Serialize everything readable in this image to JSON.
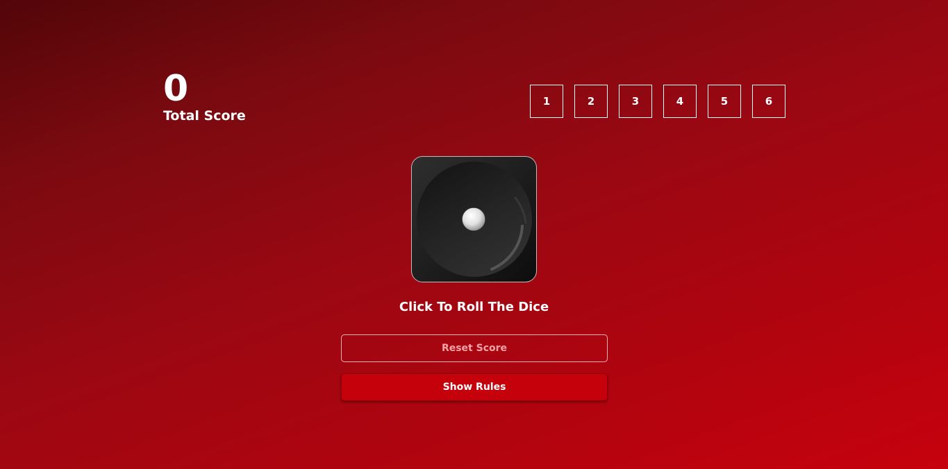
{
  "score": {
    "value": "0",
    "label": "Total Score"
  },
  "number_selector": {
    "options": [
      "1",
      "2",
      "3",
      "4",
      "5",
      "6"
    ]
  },
  "dice": {
    "face": 1,
    "icon": "dice-face-one-icon"
  },
  "instruction": "Click To Roll The Dice",
  "buttons": {
    "reset_label": "Reset Score",
    "rules_label": "Show Rules"
  },
  "colors": {
    "background_start": "#520609",
    "background_end": "#c6020d",
    "rules_button": "#c5010b",
    "reset_text": "#f3a3a7"
  }
}
